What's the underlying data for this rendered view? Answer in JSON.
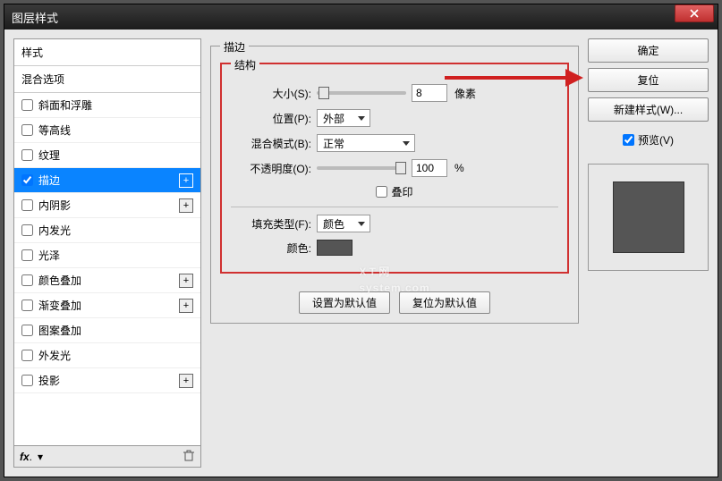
{
  "title": "图层样式",
  "left": {
    "header1": "样式",
    "header2": "混合选项",
    "items": [
      {
        "label": "斜面和浮雕",
        "checked": false,
        "plus": false
      },
      {
        "label": "等高线",
        "checked": false,
        "plus": false
      },
      {
        "label": "纹理",
        "checked": false,
        "plus": false
      },
      {
        "label": "描边",
        "checked": true,
        "plus": true,
        "selected": true
      },
      {
        "label": "内阴影",
        "checked": false,
        "plus": true
      },
      {
        "label": "内发光",
        "checked": false,
        "plus": false
      },
      {
        "label": "光泽",
        "checked": false,
        "plus": false
      },
      {
        "label": "颜色叠加",
        "checked": false,
        "plus": true
      },
      {
        "label": "渐变叠加",
        "checked": false,
        "plus": true
      },
      {
        "label": "图案叠加",
        "checked": false,
        "plus": false
      },
      {
        "label": "外发光",
        "checked": false,
        "plus": false
      },
      {
        "label": "投影",
        "checked": false,
        "plus": true
      }
    ],
    "fx": "fx"
  },
  "center": {
    "title": "描边",
    "structure": "结构",
    "size_label": "大小(S):",
    "size_value": "8",
    "size_unit": "像素",
    "position_label": "位置(P):",
    "position_value": "外部",
    "blend_label": "混合模式(B):",
    "blend_value": "正常",
    "opacity_label": "不透明度(O):",
    "opacity_value": "100",
    "opacity_unit": "%",
    "overprint": "叠印",
    "filltype_label": "填充类型(F):",
    "filltype_value": "颜色",
    "color_label": "颜色:",
    "btn_default": "设置为默认值",
    "btn_reset": "复位为默认值"
  },
  "right": {
    "ok": "确定",
    "cancel": "复位",
    "newstyle": "新建样式(W)...",
    "preview": "预览(V)"
  },
  "watermark": {
    "main": "X T 网",
    "sub": "system.com"
  }
}
